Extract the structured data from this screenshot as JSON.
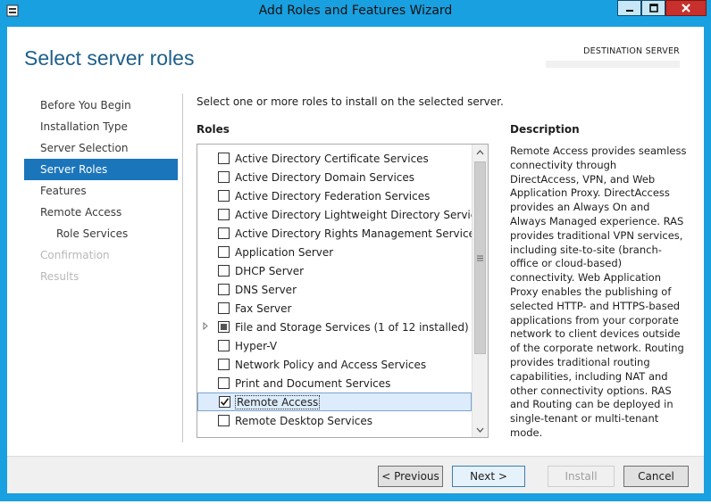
{
  "window": {
    "title": "Add Roles and Features Wizard",
    "accent_color": "#19a0e0",
    "controls": [
      "minimize-icon",
      "maximize-icon",
      "close-icon"
    ]
  },
  "header": {
    "page_title": "Select server roles",
    "destination_label": "DESTINATION SERVER"
  },
  "nav": {
    "items": [
      {
        "label": "Before You Begin",
        "state": "normal"
      },
      {
        "label": "Installation Type",
        "state": "normal"
      },
      {
        "label": "Server Selection",
        "state": "normal"
      },
      {
        "label": "Server Roles",
        "state": "active"
      },
      {
        "label": "Features",
        "state": "normal"
      },
      {
        "label": "Remote Access",
        "state": "normal"
      },
      {
        "label": "Role Services",
        "state": "normal",
        "sub": true
      },
      {
        "label": "Confirmation",
        "state": "disabled"
      },
      {
        "label": "Results",
        "state": "disabled"
      }
    ]
  },
  "main": {
    "instruction": "Select one or more roles to install on the selected server.",
    "roles_heading": "Roles",
    "description_heading": "Description",
    "roles": [
      {
        "label": "Active Directory Certificate Services",
        "checked": false
      },
      {
        "label": "Active Directory Domain Services",
        "checked": false
      },
      {
        "label": "Active Directory Federation Services",
        "checked": false
      },
      {
        "label": "Active Directory Lightweight Directory Services",
        "checked": false
      },
      {
        "label": "Active Directory Rights Management Services",
        "checked": false
      },
      {
        "label": "Application Server",
        "checked": false
      },
      {
        "label": "DHCP Server",
        "checked": false
      },
      {
        "label": "DNS Server",
        "checked": false
      },
      {
        "label": "Fax Server",
        "checked": false
      },
      {
        "label": "File and Storage Services (1 of 12 installed)",
        "checked": "partial",
        "expandable": true
      },
      {
        "label": "Hyper-V",
        "checked": false
      },
      {
        "label": "Network Policy and Access Services",
        "checked": false
      },
      {
        "label": "Print and Document Services",
        "checked": false
      },
      {
        "label": "Remote Access",
        "checked": true,
        "selected": true
      },
      {
        "label": "Remote Desktop Services",
        "checked": false
      }
    ],
    "description": "Remote Access provides seamless connectivity through DirectAccess, VPN, and Web Application Proxy. DirectAccess provides an Always On and Always Managed experience. RAS provides traditional VPN services, including site-to-site (branch-office or cloud-based) connectivity. Web Application Proxy enables the publishing of selected HTTP- and HTTPS-based applications from your corporate network to client devices outside of the corporate network. Routing provides traditional routing capabilities, including NAT and other connectivity options. RAS and Routing can be deployed in single-tenant or multi-tenant mode."
  },
  "footer": {
    "previous_label": "< Previous",
    "next_label": "Next >",
    "install_label": "Install",
    "cancel_label": "Cancel"
  }
}
